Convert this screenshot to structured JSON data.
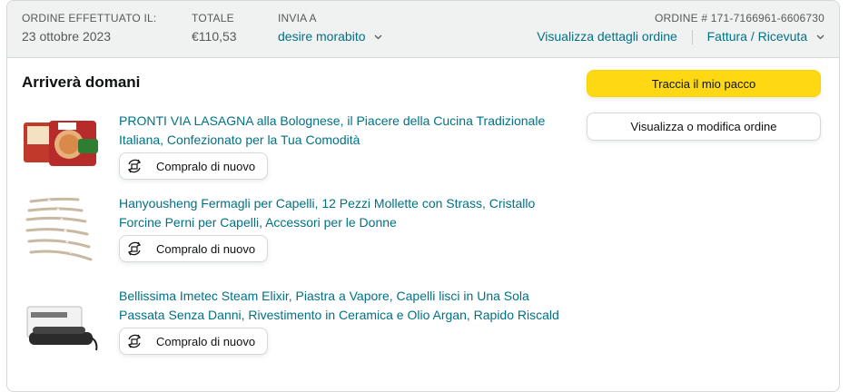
{
  "header": {
    "order_placed_label": "ORDINE EFFETTUATO IL:",
    "order_placed_value": "23 ottobre 2023",
    "total_label": "TOTALE",
    "total_value": "€110,53",
    "ship_to_label": "INVIA A",
    "ship_to_value": "desire morabito",
    "order_number_label": "ORDINE # 171-7166961-6606730",
    "details_link": "Visualizza dettagli ordine",
    "invoice_link": "Fattura / Ricevuta"
  },
  "status": {
    "title": "Arriverà domani"
  },
  "actions": {
    "track": "Traccia il mio pacco",
    "view_modify": "Visualizza o modifica ordine"
  },
  "items": [
    {
      "title": "PRONTI VIA LASAGNA alla Bolognese, il Piacere della Cucina Tradizionale Italiana, Confezionato per la Tua Comodità",
      "rebuy": "Compralo di nuovo"
    },
    {
      "title": "Hanyousheng Fermagli per Capelli, 12 Pezzi Mollette con Strass, Cristallo Forcine Perni per Capelli, Accessori per le Donne",
      "rebuy": "Compralo di nuovo"
    },
    {
      "title": "Bellissima Imetec Steam Elixir, Piastra a Vapore, Capelli lisci in Una Sola Passata Senza Danni, Rivestimento in Ceramica e Olio Argan, Rapido Riscald",
      "rebuy": "Compralo di nuovo"
    }
  ],
  "colors": {
    "link": "#007185",
    "primary_button": "#ffd814",
    "header_bg": "#f0f2f2"
  }
}
